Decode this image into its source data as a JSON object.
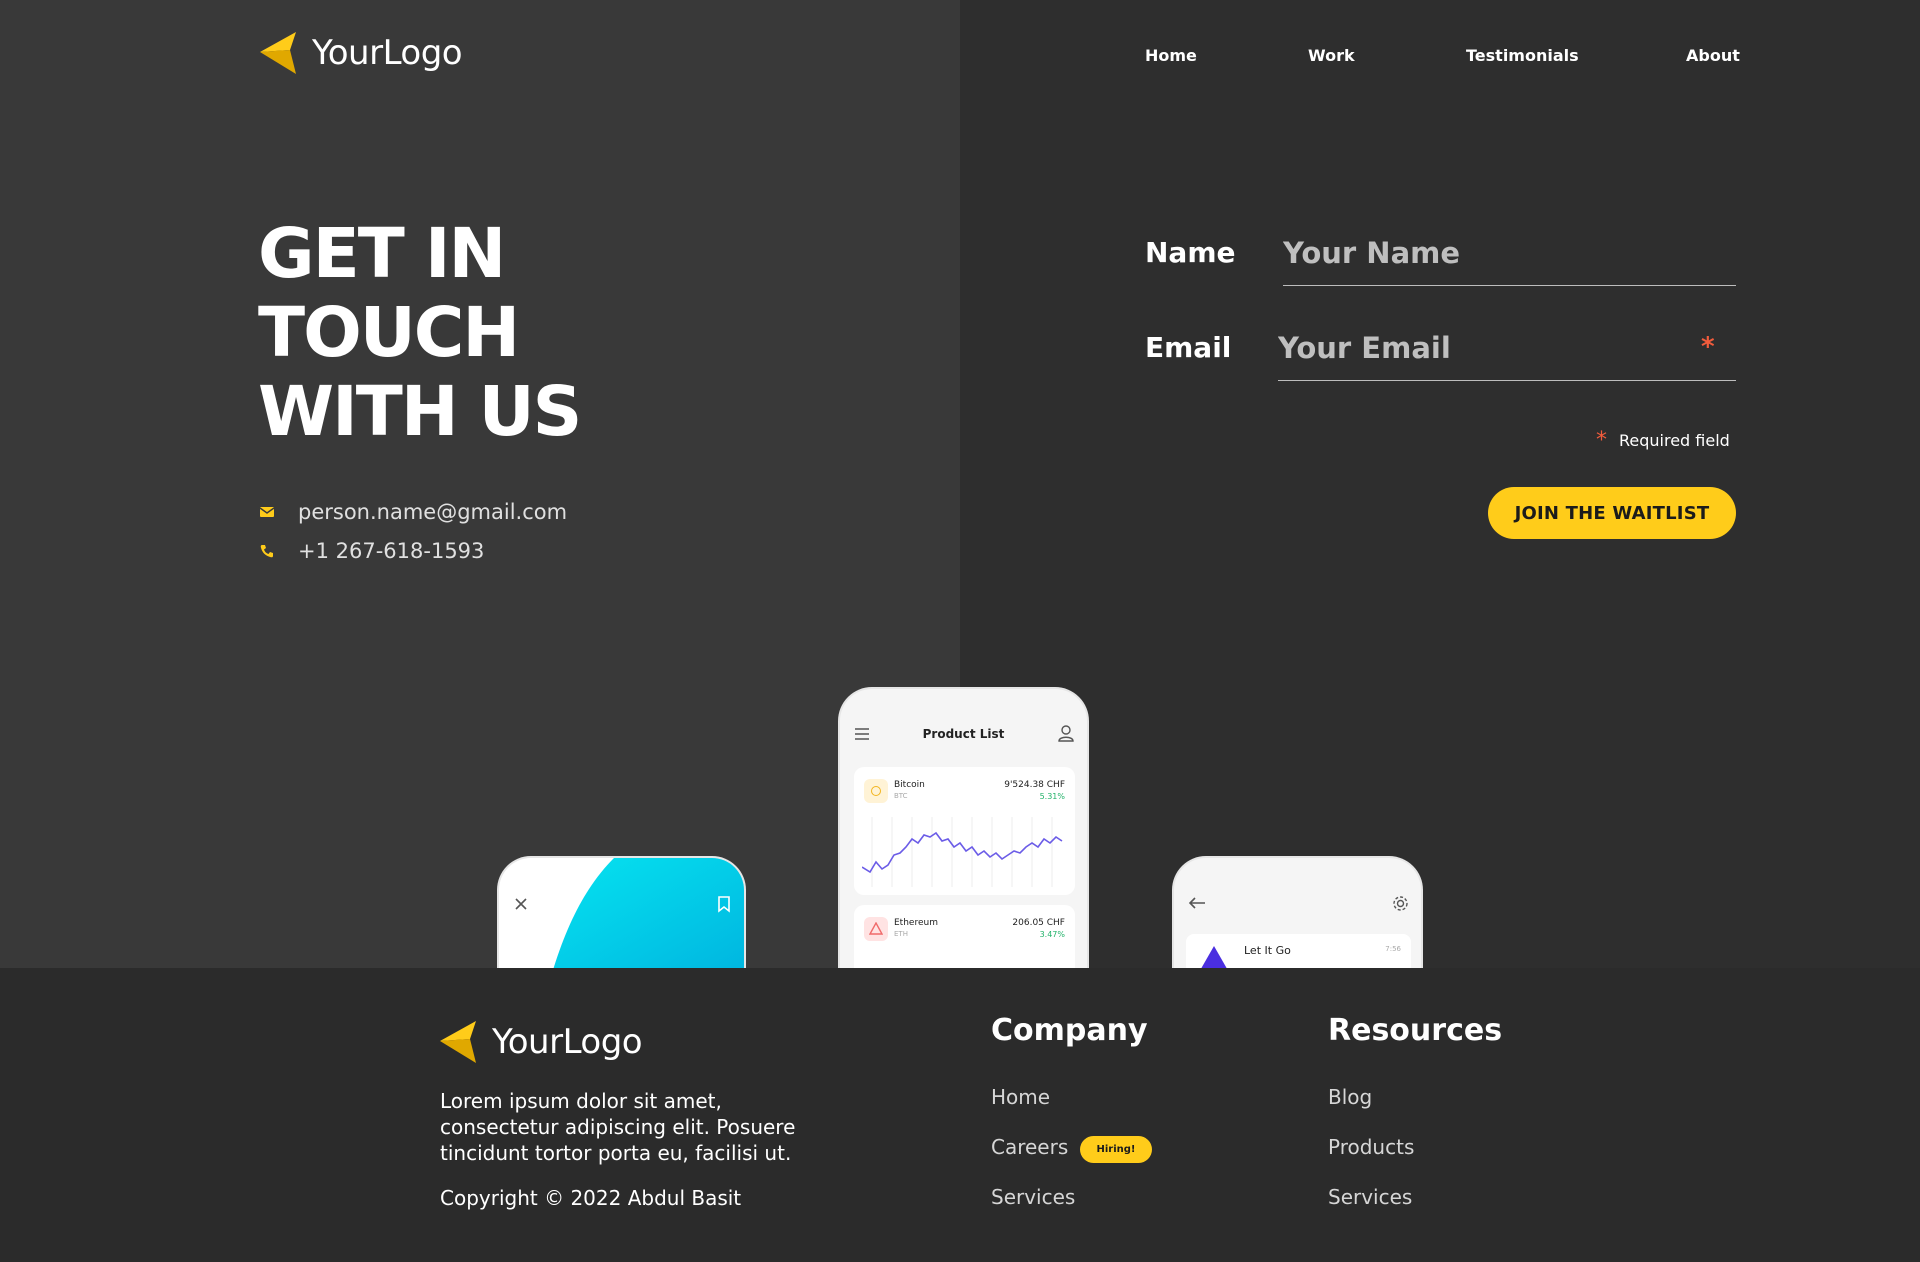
{
  "brand": {
    "logo_text": "YourLogo",
    "accent": "#ffcc1a"
  },
  "nav": [
    {
      "label": "Home"
    },
    {
      "label": "Work"
    },
    {
      "label": "Testimonials"
    },
    {
      "label": "About"
    }
  ],
  "hero": {
    "title_lines": [
      "GET IN",
      "TOUCH",
      "WITH US"
    ],
    "email": "person.name@gmail.com",
    "phone": "+1 267-618-1593"
  },
  "form": {
    "name_label": "Name",
    "name_placeholder": "Your Name",
    "email_label": "Email",
    "email_placeholder": "Your Email",
    "required_star": "*",
    "required_note": "Required field",
    "submit_label": "JOIN THE WAITLIST"
  },
  "phones": {
    "center": {
      "title": "Product List",
      "coins": [
        {
          "name": "Bitcoin",
          "symbol": "BTC",
          "price": "9'524.38 CHF",
          "change": "5.31%"
        },
        {
          "name": "Ethereum",
          "symbol": "ETH",
          "price": "206.05 CHF",
          "change": "3.47%"
        }
      ]
    },
    "right": {
      "track": "Let It Go",
      "duration": "7:56"
    }
  },
  "footer": {
    "logo_text": "YourLogo",
    "description": "Lorem ipsum dolor sit amet, consectetur adipiscing elit. Posuere tincidunt tortor porta eu, facilisi ut.",
    "copyright": "Copyright © 2022 Abdul Basit",
    "company": {
      "title": "Company",
      "links": [
        "Home",
        "Careers",
        "Services"
      ],
      "badge": "Hiring!"
    },
    "resources": {
      "title": "Resources",
      "links": [
        "Blog",
        "Products",
        "Services"
      ]
    }
  }
}
